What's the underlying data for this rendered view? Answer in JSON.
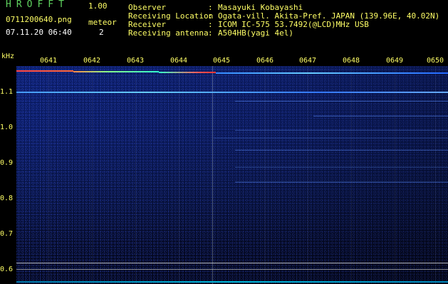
{
  "app": {
    "title": "HROFFT",
    "version": "1.00"
  },
  "file_name": "0711200640.png",
  "meteor_label": "meteor",
  "timestamp": "07.11.20 06:40",
  "meteor_count": "2",
  "info": [
    {
      "label": "Observer",
      "value": "Masayuki Kobayashi"
    },
    {
      "label": "Receiving Location",
      "value": "Ogata-vill. Akita-Pref. JAPAN (139.96E, 40.02N)"
    },
    {
      "label": "Receiver",
      "value": "ICOM IC-575 53.7492(@LCD)MHz USB"
    },
    {
      "label": "Receiving antenna",
      "value": "A504HB(yagi 4el)"
    }
  ],
  "axis": {
    "unit": "kHz",
    "y_ticks": [
      "1.1",
      "1.0",
      "0.9",
      "0.8",
      "0.7",
      "0.6"
    ],
    "x_ticks": [
      "0641",
      "0642",
      "0643",
      "0644",
      "0645",
      "0646",
      "0647",
      "0648",
      "0649",
      "0650"
    ]
  },
  "colors": {
    "label": "#ffff66",
    "title": "#5fd35f",
    "background": "#0a1a5e"
  }
}
